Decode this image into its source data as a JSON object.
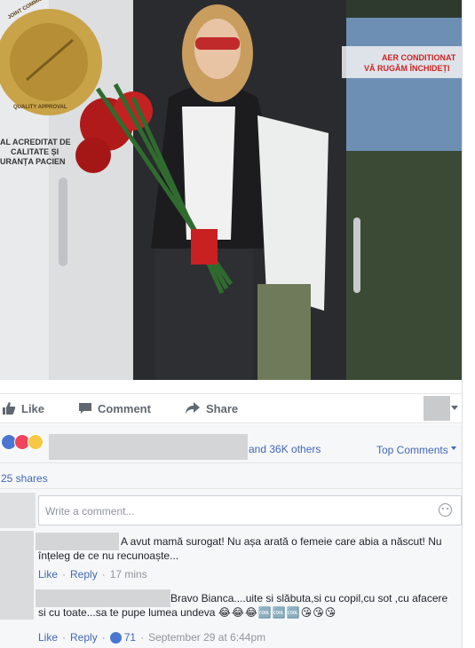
{
  "photo": {
    "sign_upper": "AER CONDITIONAT",
    "sign_lower": "VĂ RUGĂM ÎNCHIDEȚI",
    "seal_text": "JOINT COMMISSION INTERNATIONAL",
    "seal_bottom": "QUALITY APPROVAL",
    "door_text_1": "AL ACREDITAT DE",
    "door_text_2": "CALITATE ȘI",
    "door_text_3": "URANȚA PACIEN"
  },
  "actions": {
    "like": "Like",
    "comment": "Comment",
    "share": "Share"
  },
  "reactions": {
    "others": "and 36K others",
    "top_comments": "Top Comments"
  },
  "shares": "25 shares",
  "composer": {
    "placeholder": "Write a comment..."
  },
  "comments": [
    {
      "text": "A avut mamă surogat! Nu așa arată o femeie care abia a născut! Nu înțeleg de ce nu recunoaște...",
      "like": "Like",
      "reply": "Reply",
      "time": "17 mins"
    },
    {
      "text": "Bravo Bianca....uite si slăbuta,si cu copil,cu sot ,cu afacere si cu toate...sa te pupe lumea undeva",
      "emojis": "😂😂😂🆒🆒🆒😘😘😘",
      "like": "Like",
      "reply": "Reply",
      "likes": "71",
      "time": "September 29 at 6:44pm"
    }
  ],
  "colors": {
    "link": "#4267b2",
    "muted": "#90949c",
    "action": "#616770",
    "feedback_bg": "#f6f7f9"
  }
}
